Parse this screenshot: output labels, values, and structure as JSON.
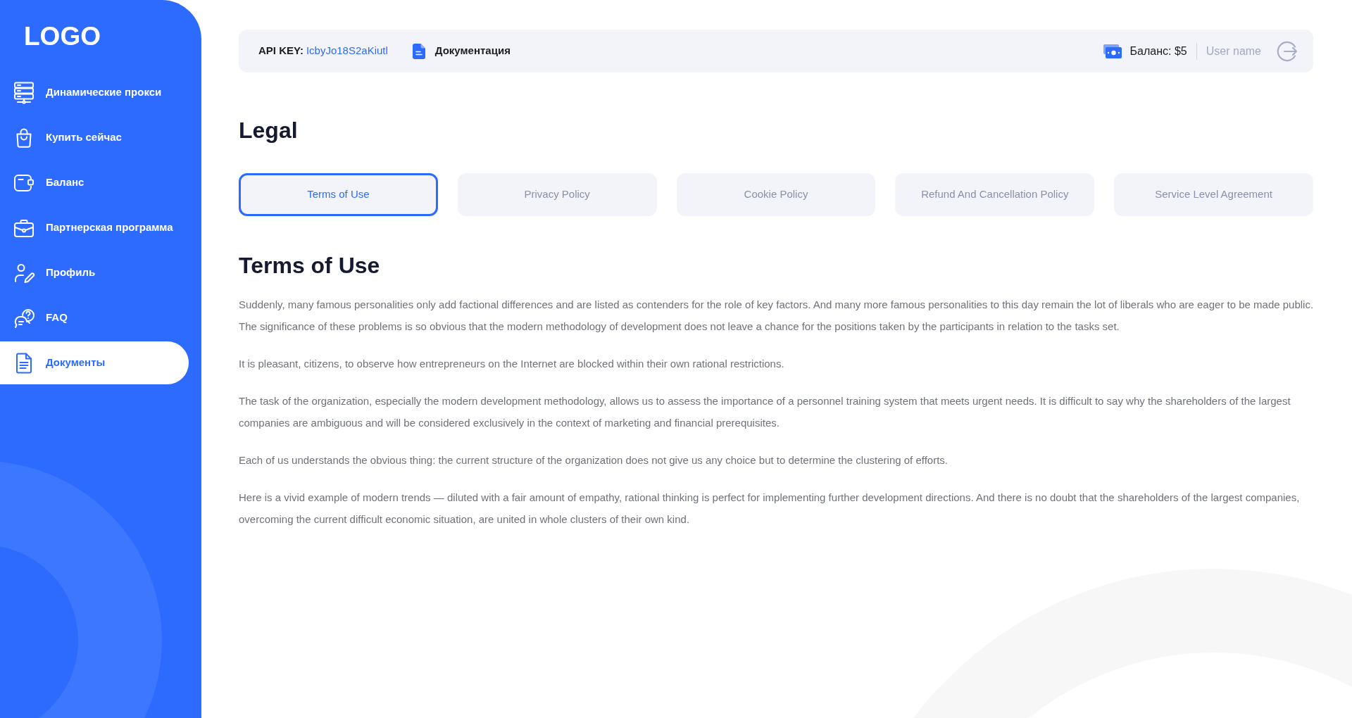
{
  "sidebar": {
    "logo": "LOGO",
    "items": [
      {
        "label": "Динамические прокси",
        "selected": false
      },
      {
        "label": "Купить сейчас",
        "selected": false
      },
      {
        "label": "Баланс",
        "selected": false
      },
      {
        "label": "Партнерская программа",
        "selected": false
      },
      {
        "label": "Профиль",
        "selected": false
      },
      {
        "label": "FAQ",
        "selected": false
      },
      {
        "label": "Документы",
        "selected": true
      }
    ]
  },
  "header": {
    "api_key_label": "API KEY:",
    "api_key": "IcbyJo18S2aKiutl",
    "docs_link": "Документация",
    "balance": "Баланс: $5",
    "username": "User name"
  },
  "page_title": "Legal",
  "tabs": [
    {
      "label": "Terms of Use",
      "selected": true
    },
    {
      "label": "Privacy Policy",
      "selected": false
    },
    {
      "label": "Cookie Policy",
      "selected": false
    },
    {
      "label": "Refund And Cancellation Policy",
      "selected": false
    },
    {
      "label": "Service Level Agreement",
      "selected": false
    }
  ],
  "document": {
    "title": "Terms of Use",
    "paragraphs": [
      "Suddenly, many famous personalities only add factional differences and are listed as contenders for the role of key factors. And many more famous personalities to this day remain the lot of liberals who are eager to be made public. The significance of these problems is so obvious that the modern methodology of development does not leave a chance for the positions taken by the participants in relation to the tasks set.",
      "It is pleasant, citizens, to observe how entrepreneurs on the Internet are blocked within their own rational restrictions.",
      "The task of the organization, especially the modern development methodology, allows us to assess the importance of a personnel training system that meets urgent needs. It is difficult to say why the shareholders of the largest companies are ambiguous and will be considered exclusively in the context of marketing and financial prerequisites.",
      "Each of us understands the obvious thing: the current structure of the organization does not give us any choice but to determine the clustering of efforts.",
      "Here is a vivid example of modern trends — diluted with a fair amount of empathy, rational thinking is perfect for implementing further development directions. And there is no doubt that the shareholders of the largest companies, overcoming the current difficult economic situation, are united in whole clusters of their own kind."
    ]
  }
}
